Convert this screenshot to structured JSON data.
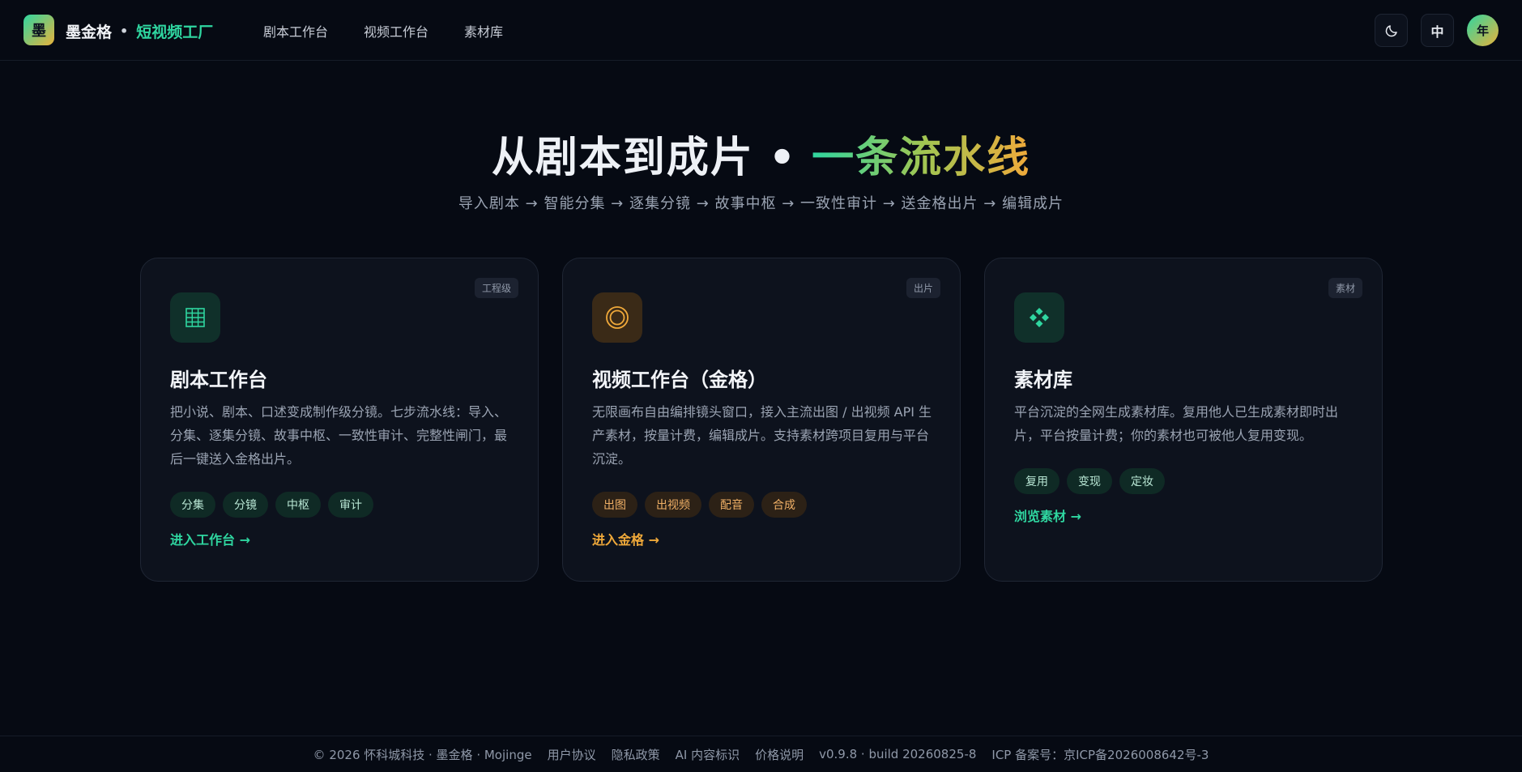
{
  "header": {
    "logo_glyph": "墨",
    "brand_name": "墨金格",
    "brand_sep": "•",
    "brand_accent": "短视频工厂",
    "nav": [
      {
        "label": "剧本工作台"
      },
      {
        "label": "视频工作台"
      },
      {
        "label": "素材库"
      }
    ],
    "lang_label": "中",
    "avatar_glyph": "年"
  },
  "hero": {
    "title_main": "从剧本到成片",
    "title_sep": "•",
    "title_accent": "一条流水线",
    "subtitle": "导入剧本 → 智能分集 → 逐集分镜 → 故事中枢 → 一致性审计 → 送金格出片 → 编辑成片"
  },
  "cards": [
    {
      "badge": "工程级",
      "title": "剧本工作台",
      "desc": "把小说、剧本、口述变成制作级分镜。七步流水线：导入、分集、逐集分镜、故事中枢、一致性审计、完整性闸门，最后一键送入金格出片。",
      "tags": [
        "分集",
        "分镜",
        "中枢",
        "审计"
      ],
      "cta": "进入工作台 →"
    },
    {
      "badge": "出片",
      "title": "视频工作台（金格）",
      "desc": "无限画布自由编排镜头窗口，接入主流出图 / 出视频 API 生产素材，按量计费，编辑成片。支持素材跨项目复用与平台沉淀。",
      "tags": [
        "出图",
        "出视频",
        "配音",
        "合成"
      ],
      "cta": "进入金格 →"
    },
    {
      "badge": "素材",
      "title": "素材库",
      "desc": "平台沉淀的全网生成素材库。复用他人已生成素材即时出片，平台按量计费；你的素材也可被他人复用变现。",
      "tags": [
        "复用",
        "变现",
        "定妆"
      ],
      "cta": "浏览素材 →"
    }
  ],
  "footer": {
    "copyright": "© 2026 怀科城科技 · 墨金格 · Mojinge",
    "links": [
      "用户协议",
      "隐私政策",
      "AI 内容标识",
      "价格说明"
    ],
    "version": "v0.9.8 · build 20260825-8",
    "icp": "ICP 备案号：京ICP备2026008642号-3"
  },
  "colors": {
    "accent_green": "#2fd6a0",
    "accent_orange": "#f0a93a",
    "background": "#060a13"
  }
}
